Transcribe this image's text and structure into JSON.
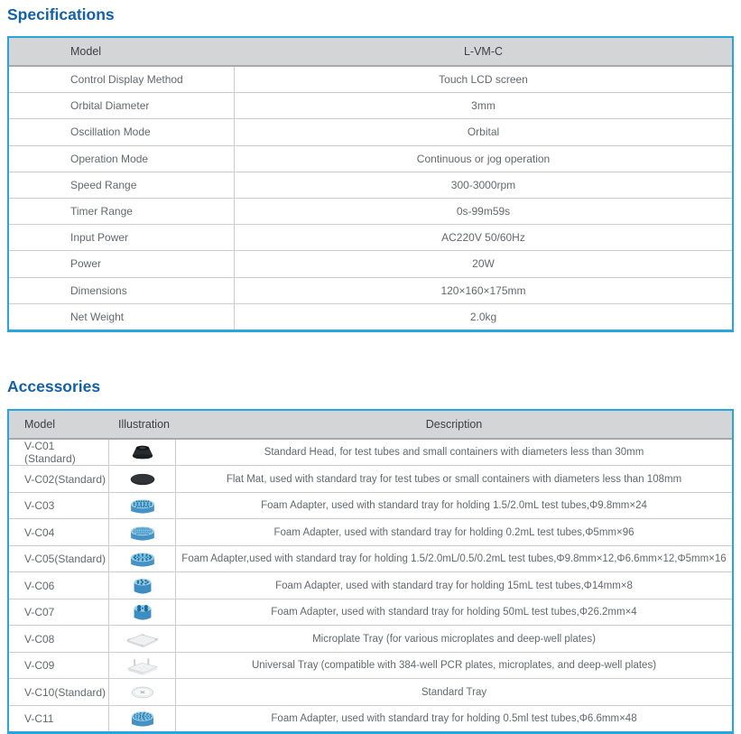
{
  "colors": {
    "accent_blue": "#1261A8",
    "table_border_blue": "#2AA4DC",
    "header_gray": "#D3D5D7"
  },
  "page": {
    "specifications_title": "Specifications",
    "accessories_title": "Accessories"
  },
  "spec_table": {
    "header": {
      "model_label": "Model",
      "model_value": "L-VM-C"
    },
    "rows": [
      {
        "label": "Control Display Method",
        "value": "Touch LCD screen"
      },
      {
        "label": "Orbital Diameter",
        "value": "3mm"
      },
      {
        "label": "Oscillation Mode",
        "value": "Orbital"
      },
      {
        "label": "Operation Mode",
        "value": "Continuous or jog operation"
      },
      {
        "label": "Speed Range",
        "value": "300-3000rpm"
      },
      {
        "label": "Timer Range",
        "value": "0s-99m59s"
      },
      {
        "label": "Input Power",
        "value": "AC220V 50/60Hz"
      },
      {
        "label": "Power",
        "value": "20W"
      },
      {
        "label": "Dimensions",
        "value": "120×160×175mm"
      },
      {
        "label": "Net Weight",
        "value": "2.0kg"
      }
    ]
  },
  "accessories_table": {
    "headers": {
      "model": "Model",
      "illustration": "Illustration",
      "description": "Description"
    },
    "rows": [
      {
        "model": "V-C01 (Standard)",
        "illustration": "standard-head-icon",
        "description": "Standard Head, for test tubes and small containers with diameters less than 30mm"
      },
      {
        "model": "V-C02(Standard)",
        "illustration": "flat-mat-icon",
        "description": "Flat Mat, used with standard tray for test tubes or small containers with diameters less than 108mm"
      },
      {
        "model": "V-C03",
        "illustration": "foam-adapter-24-icon",
        "description": "Foam Adapter, used with standard tray for holding 1.5/2.0mL test tubes,Φ9.8mm×24"
      },
      {
        "model": "V-C04",
        "illustration": "foam-adapter-96-icon",
        "description": "Foam Adapter, used with standard tray for holding 0.2mL test tubes,Φ5mm×96"
      },
      {
        "model": "V-C05(Standard)",
        "illustration": "foam-adapter-mixed-icon",
        "description": "Foam Adapter,used with standard tray for holding 1.5/2.0mL/0.5/0.2mL test tubes,Φ9.8mm×12,Φ6.6mm×12,Φ5mm×16"
      },
      {
        "model": "V-C06",
        "illustration": "foam-adapter-15ml-icon",
        "description": "Foam Adapter, used with standard tray for holding 15mL test tubes,Φ14mm×8"
      },
      {
        "model": "V-C07",
        "illustration": "foam-adapter-50ml-icon",
        "description": "Foam Adapter, used with standard tray for holding 50mL test tubes,Φ26.2mm×4"
      },
      {
        "model": "V-C08",
        "illustration": "microplate-tray-icon",
        "description": "Microplate Tray (for various microplates and deep-well plates)"
      },
      {
        "model": "V-C09",
        "illustration": "universal-tray-icon",
        "description": "Universal Tray (compatible with 384-well PCR plates, microplates, and deep-well plates)"
      },
      {
        "model": "V-C10(Standard)",
        "illustration": "standard-tray-icon",
        "description": "Standard Tray"
      },
      {
        "model": "V-C11",
        "illustration": "foam-adapter-48-icon",
        "description": "Foam Adapter, used with standard tray for holding 0.5ml test tubes,Φ6.6mm×48"
      }
    ]
  }
}
